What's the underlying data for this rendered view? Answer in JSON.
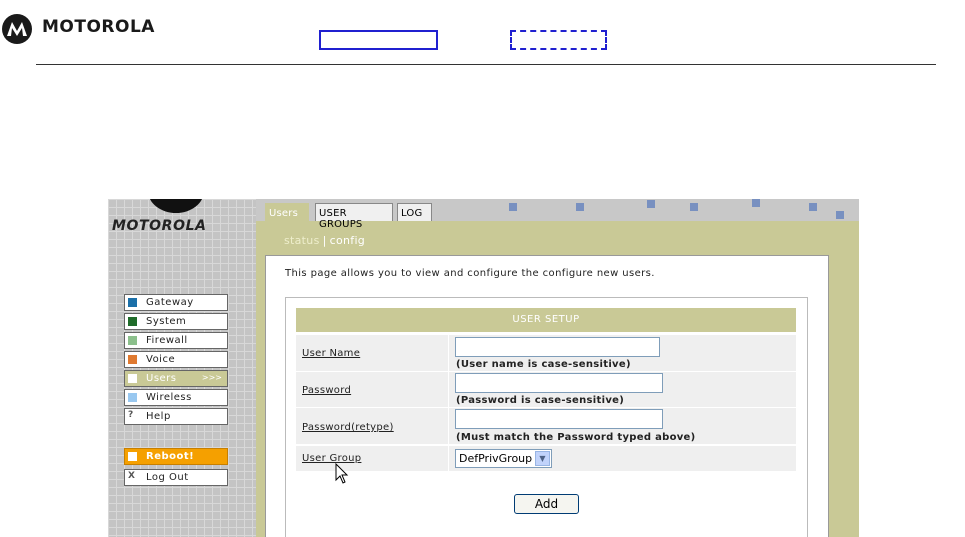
{
  "header": {
    "brand": "MOTOROLA"
  },
  "sidebar": {
    "brand": "MOTOROLA",
    "items": [
      {
        "label": "Gateway",
        "color": "#1a6fa8"
      },
      {
        "label": "System",
        "color": "#1f6b2a"
      },
      {
        "label": "Firewall",
        "color": "#8cc08c"
      },
      {
        "label": "Voice",
        "color": "#e07a30"
      },
      {
        "label": "Users",
        "color": "#ffffff",
        "active": true,
        "arrows": ">>>"
      },
      {
        "label": "Wireless",
        "color": "#99c8f0"
      },
      {
        "label": "Help",
        "icon": "?"
      }
    ],
    "reboot": "Reboot!",
    "logout": {
      "label": "Log Out",
      "icon": "X"
    }
  },
  "tabs": [
    {
      "label": "Users",
      "active": true
    },
    {
      "label": "USER GROUPS"
    },
    {
      "label": "LOG"
    }
  ],
  "subnav": {
    "status": "status",
    "separator": "|",
    "config": "config"
  },
  "intro": "This page allows you to view and configure the configure new users.",
  "form": {
    "title": "USER SETUP",
    "fields": [
      {
        "label": "User Name",
        "value": "",
        "hint": "(User name is case-sensitive)"
      },
      {
        "label": "Password",
        "value": "",
        "hint": "(Password is case-sensitive)"
      },
      {
        "label": "Password(retype)",
        "value": "",
        "hint": "(Must match the Password typed above)"
      }
    ],
    "group": {
      "label": "User Group",
      "selected": "DefPrivGroup"
    },
    "add_button": "Add"
  },
  "colors": {
    "accent": "#c9c996",
    "reboot": "#f5a000",
    "header_boxes": "#2020d0"
  }
}
